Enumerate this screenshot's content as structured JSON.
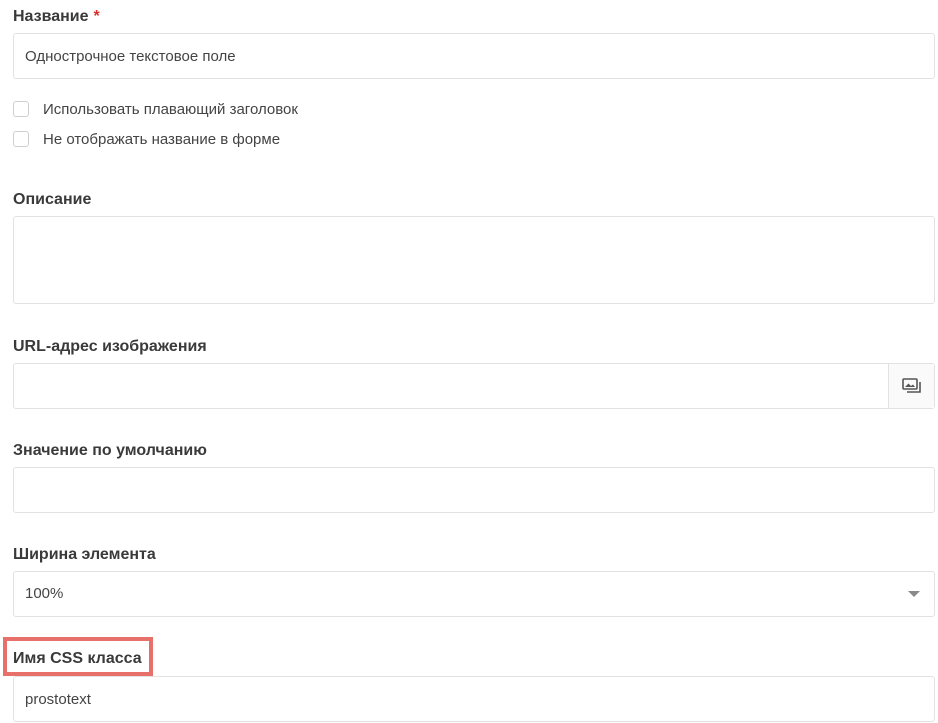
{
  "form": {
    "name": {
      "label": "Название",
      "required_mark": "*",
      "value": "Однострочное текстовое поле"
    },
    "checkboxes": [
      {
        "label": "Использовать плавающий заголовок",
        "checked": false
      },
      {
        "label": "Не отображать название в форме",
        "checked": false
      }
    ],
    "description": {
      "label": "Описание",
      "value": ""
    },
    "image_url": {
      "label": "URL-адрес изображения",
      "value": "",
      "button_icon": "image-gallery-icon"
    },
    "default_value": {
      "label": "Значение по умолчанию",
      "value": ""
    },
    "element_width": {
      "label": "Ширина элемента",
      "selected": "100%"
    },
    "css_class": {
      "label": "Имя CSS класса",
      "value": "prostotext"
    }
  },
  "colors": {
    "required": "#d9302c",
    "highlight": "#e8706a",
    "border": "#e2e2e2"
  }
}
